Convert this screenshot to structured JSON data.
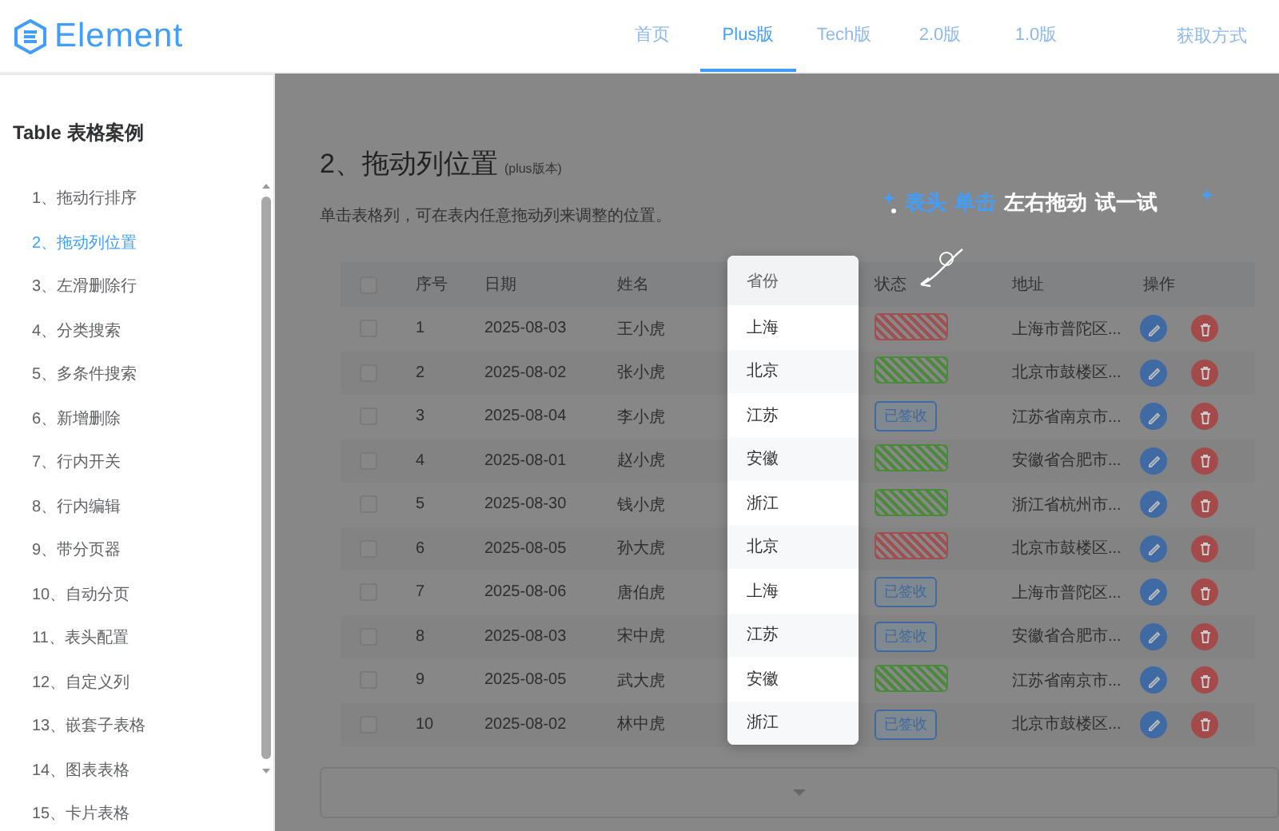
{
  "header": {
    "logo": "Element",
    "nav": [
      {
        "label": "首页",
        "selected": false
      },
      {
        "label": "Plus版",
        "selected": true
      },
      {
        "label": "Tech版",
        "selected": false
      },
      {
        "label": "2.0版",
        "selected": false
      },
      {
        "label": "1.0版",
        "selected": false
      }
    ],
    "action": "获取方式"
  },
  "sidebar": {
    "title": "Table 表格案例",
    "items": [
      {
        "label": "1、拖动行排序",
        "selected": false
      },
      {
        "label": "2、拖动列位置",
        "selected": true
      },
      {
        "label": "3、左滑删除行",
        "selected": false
      },
      {
        "label": "4、分类搜索",
        "selected": false
      },
      {
        "label": "5、多条件搜索",
        "selected": false
      },
      {
        "label": "6、新增删除",
        "selected": false
      },
      {
        "label": "7、行内开关",
        "selected": false
      },
      {
        "label": "8、行内编辑",
        "selected": false
      },
      {
        "label": "9、带分页器",
        "selected": false
      },
      {
        "label": "10、自动分页",
        "selected": false
      },
      {
        "label": "11、表头配置",
        "selected": false
      },
      {
        "label": "12、自定义列",
        "selected": false
      },
      {
        "label": "13、嵌套子表格",
        "selected": false
      },
      {
        "label": "14、图表表格",
        "selected": false
      },
      {
        "label": "15、卡片表格",
        "selected": false
      }
    ]
  },
  "page": {
    "title": "2、拖动列位置",
    "badge": "(plus版本)",
    "description": "单击表格列，可在表内任意拖动列来调整的位置。",
    "hint": [
      {
        "text": "表头",
        "highlight": true
      },
      {
        "text": "单击",
        "highlight": true
      },
      {
        "text": "左右拖动",
        "highlight": false
      },
      {
        "text": "试一试",
        "highlight": false
      }
    ]
  },
  "table": {
    "all_checked": false,
    "columns": [
      {
        "label": "序号",
        "dragged": false
      },
      {
        "label": "日期",
        "dragged": false
      },
      {
        "label": "姓名",
        "dragged": false
      },
      {
        "label": "省份",
        "dragged": true
      },
      {
        "label": "状态",
        "dragged": false
      },
      {
        "label": "地址",
        "dragged": false
      },
      {
        "label": "操作",
        "dragged": false
      }
    ],
    "rows": [
      {
        "checked": false,
        "cells": [
          "1",
          "2025-08-03",
          "王小虎",
          "上海"
        ],
        "status": {
          "color": "#a05050"
        },
        "address": "上海市普陀区..."
      },
      {
        "checked": false,
        "cells": [
          "2",
          "2025-08-02",
          "张小虎",
          "北京"
        ],
        "status": {
          "color": "#4a8a3a"
        },
        "address": "北京市鼓楼区..."
      },
      {
        "checked": false,
        "cells": [
          "3",
          "2025-08-04",
          "李小虎",
          "江苏"
        ],
        "status": {
          "label": "已签收",
          "color": "#3d6aa0"
        },
        "address": "江苏省南京市..."
      },
      {
        "checked": false,
        "cells": [
          "4",
          "2025-08-01",
          "赵小虎",
          "安徽"
        ],
        "status": {
          "color": "#4a8a3a"
        },
        "address": "安徽省合肥市..."
      },
      {
        "checked": false,
        "cells": [
          "5",
          "2025-08-30",
          "钱小虎",
          "浙江"
        ],
        "status": {
          "color": "#4a8a3a"
        },
        "address": "浙江省杭州市..."
      },
      {
        "checked": false,
        "cells": [
          "6",
          "2025-08-05",
          "孙大虎",
          "北京"
        ],
        "status": {
          "color": "#a05050"
        },
        "address": "北京市鼓楼区..."
      },
      {
        "checked": false,
        "cells": [
          "7",
          "2025-08-06",
          "唐伯虎",
          "上海"
        ],
        "status": {
          "label": "已签收",
          "color": "#3d6aa0"
        },
        "address": "上海市普陀区..."
      },
      {
        "checked": false,
        "cells": [
          "8",
          "2025-08-03",
          "宋中虎",
          "江苏"
        ],
        "status": {
          "label": "已签收",
          "color": "#3d6aa0"
        },
        "address": "安徽省合肥市..."
      },
      {
        "checked": false,
        "cells": [
          "9",
          "2025-08-05",
          "武大虎",
          "安徽"
        ],
        "status": {
          "color": "#4a8a3a"
        },
        "address": "江苏省南京市..."
      },
      {
        "checked": false,
        "cells": [
          "10",
          "2025-08-02",
          "林中虎",
          "浙江"
        ],
        "status": {
          "label": "已签收",
          "color": "#3d6aa0"
        },
        "address": "北京市鼓楼区..."
      }
    ]
  }
}
